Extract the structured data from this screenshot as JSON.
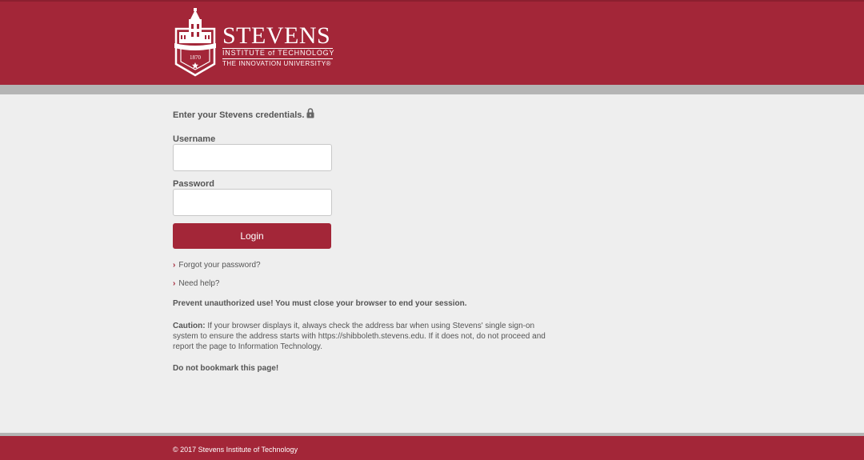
{
  "header": {
    "brand_name": "STEVENS",
    "brand_sub1": "INSTITUTE of TECHNOLOGY",
    "brand_sub2": "THE INNOVATION UNIVERSITY®",
    "seal_year": "1870",
    "brand_color": "#a32638"
  },
  "login": {
    "prompt": "Enter your Stevens credentials.",
    "lock_icon": "lock-icon",
    "username_label": "Username",
    "username_value": "",
    "password_label": "Password",
    "password_value": "",
    "login_button": "Login",
    "forgot_link": "Forgot your password?",
    "help_link": "Need help?"
  },
  "notices": {
    "warning": "Prevent unauthorized use! You must close your browser to end your session.",
    "caution_label": "Caution:",
    "caution_text": "If your browser displays it, always check the address bar when using Stevens' single sign-on system to ensure the address starts with https://shibboleth.stevens.edu. If it does not, do not proceed and report the page to Information Technology.",
    "bookmark": "Do not bookmark this page!"
  },
  "footer": {
    "copyright": "© 2017 Stevens Institute of Technology"
  }
}
